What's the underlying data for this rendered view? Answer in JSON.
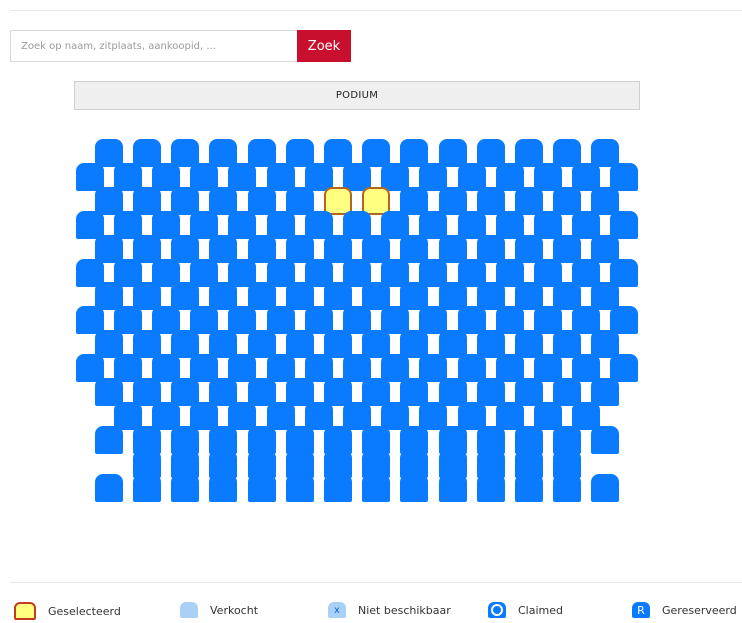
{
  "search": {
    "placeholder": "Zoek op naam, zitplaats, aankoopid, ...",
    "value": "",
    "button_label": "Zoek"
  },
  "stage": {
    "label": "PODIUM"
  },
  "colors": {
    "seat_available": "#0a7aff",
    "seat_selected_fill": "#ffff80",
    "seat_selected_border": "#b5651d",
    "seat_sold": "#a9d0f5",
    "accent": "#c8102e"
  },
  "seat_rows": [
    {
      "count": 14,
      "selected": []
    },
    {
      "count": 15,
      "selected": []
    },
    {
      "count": 14,
      "selected": [
        6,
        7
      ]
    },
    {
      "count": 15,
      "selected": []
    },
    {
      "count": 14,
      "selected": []
    },
    {
      "count": 15,
      "selected": []
    },
    {
      "count": 14,
      "selected": []
    },
    {
      "count": 15,
      "selected": []
    },
    {
      "count": 14,
      "selected": []
    },
    {
      "count": 15,
      "selected": []
    },
    {
      "count": 14,
      "selected": []
    },
    {
      "count": 13,
      "selected": []
    },
    {
      "count": 14,
      "selected": []
    },
    {
      "count": 12,
      "selected": []
    },
    {
      "count": 14,
      "selected": []
    }
  ],
  "legend": [
    {
      "label": "Geselecteerd",
      "icon": "selected-seat-icon",
      "glyph": ""
    },
    {
      "label": "Verkocht",
      "icon": "sold-seat-icon",
      "glyph": ""
    },
    {
      "label": "Niet beschikbaar",
      "icon": "unavailable-seat-icon",
      "glyph": "x"
    },
    {
      "label": "Claimed",
      "icon": "claimed-seat-icon",
      "glyph": ""
    },
    {
      "label": "Gereserveerd",
      "icon": "reserved-seat-icon",
      "glyph": "R"
    }
  ]
}
